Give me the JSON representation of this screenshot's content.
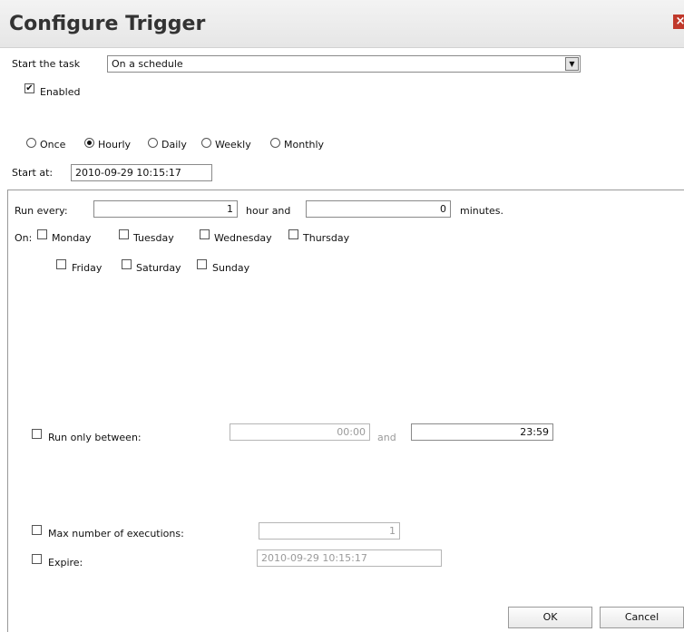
{
  "dialog": {
    "title": "Configure Trigger",
    "close_glyph": "×"
  },
  "start": {
    "label": "Start the task",
    "selected": "On a schedule",
    "dropdown_arrow": "▼"
  },
  "enabled": {
    "label": "Enabled",
    "checked": true,
    "mark": "✔"
  },
  "frequency": {
    "options": [
      "Once",
      "Hourly",
      "Daily",
      "Weekly",
      "Monthly"
    ],
    "selected": "Hourly"
  },
  "start_at": {
    "label": "Start at:",
    "value": "2010-09-29 10:15:17"
  },
  "run_every": {
    "label": "Run every:",
    "hours": "1",
    "hour_label": "hour and",
    "minutes": "0",
    "minutes_label": "minutes."
  },
  "days": {
    "label": "On:",
    "row1": [
      "Monday",
      "Tuesday",
      "Wednesday",
      "Thursday"
    ],
    "row2": [
      "Friday",
      "Saturday",
      "Sunday"
    ]
  },
  "run_between": {
    "label": "Run only between:",
    "from": "00:00",
    "and_label": "and",
    "to": "23:59"
  },
  "max_exec": {
    "label": "Max number of executions:",
    "value": "1"
  },
  "expire": {
    "label": "Expire:",
    "value": "2010-09-29 10:15:17"
  },
  "buttons": {
    "ok": "OK",
    "cancel": "Cancel"
  }
}
